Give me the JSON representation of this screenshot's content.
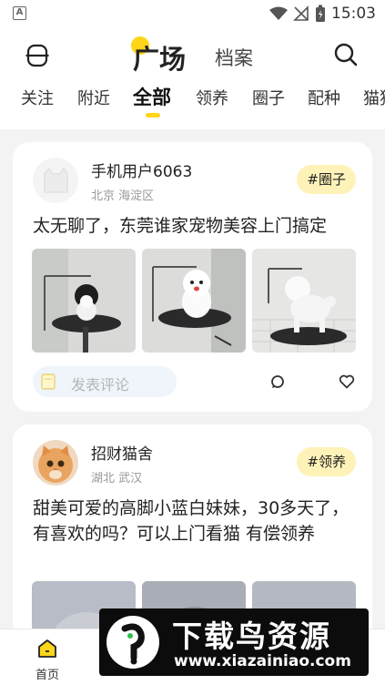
{
  "status_bar": {
    "time": "15:03",
    "notification_letter": "A"
  },
  "header": {
    "title_active": "广场",
    "title_secondary": "档案"
  },
  "tabs": [
    {
      "label": "关注",
      "active": false
    },
    {
      "label": "附近",
      "active": false
    },
    {
      "label": "全部",
      "active": true
    },
    {
      "label": "领养",
      "active": false
    },
    {
      "label": "圈子",
      "active": false
    },
    {
      "label": "配种",
      "active": false
    },
    {
      "label": "猫狗",
      "active": false
    }
  ],
  "posts": [
    {
      "username": "手机用户6063",
      "location": "北京 海淀区",
      "tag": "#圈子",
      "text": "太无聊了，东莞谁家宠物美容上门搞定",
      "comment_placeholder": "发表评论"
    },
    {
      "username": "招财猫舍",
      "location": "湖北 武汉",
      "tag": "#领养",
      "text": "甜美可爱的高脚小蓝白妹妹，30多天了，有喜欢的吗？可以上门看猫 有偿领养"
    }
  ],
  "bottom_nav": [
    {
      "label": "首页",
      "active": true
    },
    {
      "label": "",
      "active": false
    },
    {
      "label": "",
      "active": false
    },
    {
      "label": "",
      "active": false
    },
    {
      "label": "",
      "active": false
    }
  ],
  "watermark": {
    "title": "下载鸟资源",
    "url": "www.xiazainiao.com"
  },
  "colors": {
    "accent": "#ffd51a",
    "tag_bg": "#fff2b8",
    "page_bg": "#f3f3f3"
  }
}
